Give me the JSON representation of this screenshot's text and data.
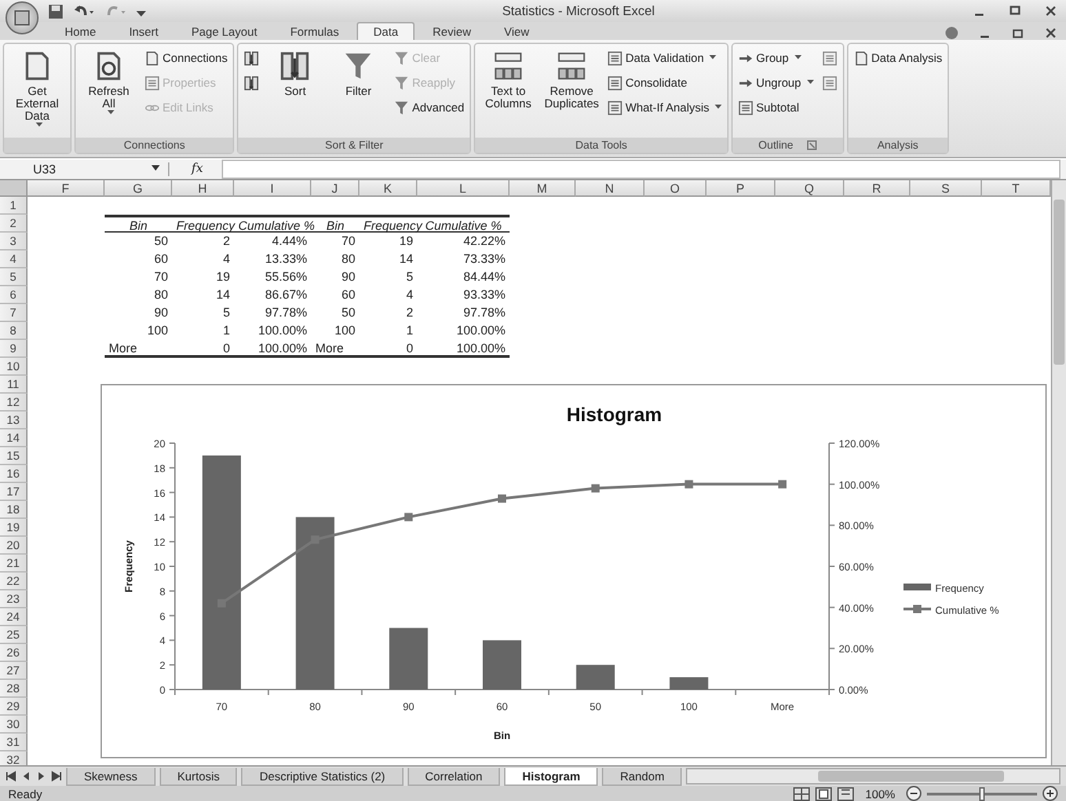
{
  "window": {
    "title": "Statistics - Microsoft Excel"
  },
  "ribbon_tabs": [
    {
      "label": "Home",
      "selected": false
    },
    {
      "label": "Insert",
      "selected": false
    },
    {
      "label": "Page Layout",
      "selected": false
    },
    {
      "label": "Formulas",
      "selected": false
    },
    {
      "label": "Data",
      "selected": true
    },
    {
      "label": "Review",
      "selected": false
    },
    {
      "label": "View",
      "selected": false
    }
  ],
  "ribbon_groups": [
    {
      "launcher": false,
      "items": [
        {
          "kind": "large",
          "label": "Get External Data",
          "dropdown": true,
          "disabled": false
        }
      ]
    },
    {
      "label": "Connections",
      "launcher": false,
      "items": [
        {
          "kind": "large",
          "label": "Refresh All",
          "dropdown": true,
          "disabled": false
        },
        {
          "kind": "small",
          "label": "Connections",
          "dropdown": false,
          "disabled": false
        },
        {
          "kind": "small",
          "label": "Properties",
          "dropdown": false,
          "disabled": true
        },
        {
          "kind": "small",
          "label": "Edit Links",
          "dropdown": false,
          "disabled": true
        }
      ]
    },
    {
      "label": "Sort & Filter",
      "launcher": false,
      "items": [
        {
          "kind": "small",
          "dropdown": false,
          "disabled": false
        },
        {
          "kind": "small",
          "dropdown": false,
          "disabled": false
        },
        {
          "kind": "large",
          "label": "Sort",
          "dropdown": false,
          "disabled": false
        },
        {
          "kind": "large",
          "label": "Filter",
          "dropdown": false,
          "disabled": false
        },
        {
          "kind": "small",
          "label": "Clear",
          "dropdown": false,
          "disabled": true
        },
        {
          "kind": "small",
          "label": "Reapply",
          "dropdown": false,
          "disabled": true
        },
        {
          "kind": "small",
          "label": "Advanced",
          "dropdown": false,
          "disabled": false
        }
      ]
    },
    {
      "label": "Data Tools",
      "launcher": false,
      "items": [
        {
          "kind": "large",
          "label": "Text to Columns",
          "dropdown": false,
          "disabled": false
        },
        {
          "kind": "large",
          "label": "Remove Duplicates",
          "dropdown": false,
          "disabled": false
        },
        {
          "kind": "small",
          "label": "Data Validation",
          "dropdown": true,
          "disabled": false
        },
        {
          "kind": "small",
          "label": "Consolidate",
          "dropdown": false,
          "disabled": false
        },
        {
          "kind": "small",
          "label": "What-If Analysis",
          "dropdown": true,
          "disabled": false
        }
      ]
    },
    {
      "label": "Outline",
      "launcher": true,
      "items": [
        {
          "kind": "small",
          "label": "Group",
          "dropdown": true,
          "disabled": false
        },
        {
          "kind": "small",
          "label": "Ungroup",
          "dropdown": true,
          "disabled": false
        },
        {
          "kind": "small",
          "label": "Subtotal",
          "dropdown": false,
          "disabled": false
        },
        {
          "kind": "small",
          "dropdown": false,
          "disabled": true
        },
        {
          "kind": "small",
          "dropdown": false,
          "disabled": true
        }
      ]
    },
    {
      "label": "Analysis",
      "launcher": false,
      "items": [
        {
          "kind": "small",
          "label": "Data Analysis",
          "dropdown": false,
          "disabled": false
        }
      ]
    }
  ],
  "formula_bar": {
    "name_box": "U33",
    "fx": "fx"
  },
  "columns": [
    "F",
    "G",
    "H",
    "I",
    "J",
    "K",
    "L",
    "M",
    "N",
    "O",
    "P",
    "Q",
    "R",
    "S",
    "T"
  ],
  "rows": [
    "1",
    "2",
    "3",
    "4",
    "5",
    "6",
    "7",
    "8",
    "9",
    "10",
    "11",
    "12",
    "13",
    "14",
    "15",
    "16",
    "17",
    "18",
    "19",
    "20",
    "21",
    "22",
    "23",
    "24",
    "25",
    "26",
    "27",
    "28",
    "29",
    "30",
    "31",
    "32"
  ],
  "table": {
    "columns": [
      "Bin",
      "Frequency",
      "Cumulative %",
      "Bin",
      "Frequency",
      "Cumulative %"
    ],
    "rows": [
      [
        "50",
        "2",
        "4.44%",
        "70",
        "19",
        "42.22%"
      ],
      [
        "60",
        "4",
        "13.33%",
        "80",
        "14",
        "73.33%"
      ],
      [
        "70",
        "19",
        "55.56%",
        "90",
        "5",
        "84.44%"
      ],
      [
        "80",
        "14",
        "86.67%",
        "60",
        "4",
        "93.33%"
      ],
      [
        "90",
        "5",
        "97.78%",
        "50",
        "2",
        "97.78%"
      ],
      [
        "100",
        "1",
        "100.00%",
        "100",
        "1",
        "100.00%"
      ],
      [
        "More",
        "0",
        "100.00%",
        "More",
        "0",
        "100.00%"
      ]
    ]
  },
  "chart": {
    "chart_data": {
      "type": "bar",
      "title": "Histogram",
      "xlabel": "Bin",
      "ylabel": "Frequency",
      "categories": [
        "70",
        "80",
        "90",
        "60",
        "50",
        "100",
        "More"
      ],
      "series": [
        {
          "name": "Frequency",
          "color": "#666666",
          "values": [
            19,
            14,
            5,
            4,
            2,
            1,
            0
          ]
        },
        {
          "name": "Cumulative %",
          "color": "#777777",
          "axis": "y2",
          "type": "line",
          "marker": "square",
          "values": [
            42,
            73,
            84,
            93,
            98,
            100,
            100
          ]
        }
      ],
      "legend": "right",
      "ylim": [
        0,
        20
      ],
      "yticks": [
        0,
        2,
        4,
        6,
        8,
        10,
        12,
        14,
        16,
        18,
        20
      ],
      "y2lim": [
        0,
        120
      ],
      "y2ticks": [
        {
          "value": 0,
          "label": "0.00%"
        },
        {
          "value": 20,
          "label": "20.00%"
        },
        {
          "value": 40,
          "label": "40.00%"
        },
        {
          "value": 60,
          "label": "60.00%"
        },
        {
          "value": 80,
          "label": "80.00%"
        },
        {
          "value": 100,
          "label": "100.00%"
        },
        {
          "value": 120,
          "label": "120.00%"
        }
      ]
    }
  },
  "sheet_tabs": [
    {
      "label": "Skewness",
      "selected": false
    },
    {
      "label": "Kurtosis",
      "selected": false
    },
    {
      "label": "Descriptive Statistics (2)",
      "selected": false
    },
    {
      "label": "Correlation",
      "selected": false
    },
    {
      "label": "Histogram",
      "selected": true
    },
    {
      "label": "Random",
      "selected": false
    }
  ],
  "status_bar": {
    "status": "Ready",
    "zoom": "100%",
    "zoom_slider": {
      "level": 0.5
    }
  }
}
